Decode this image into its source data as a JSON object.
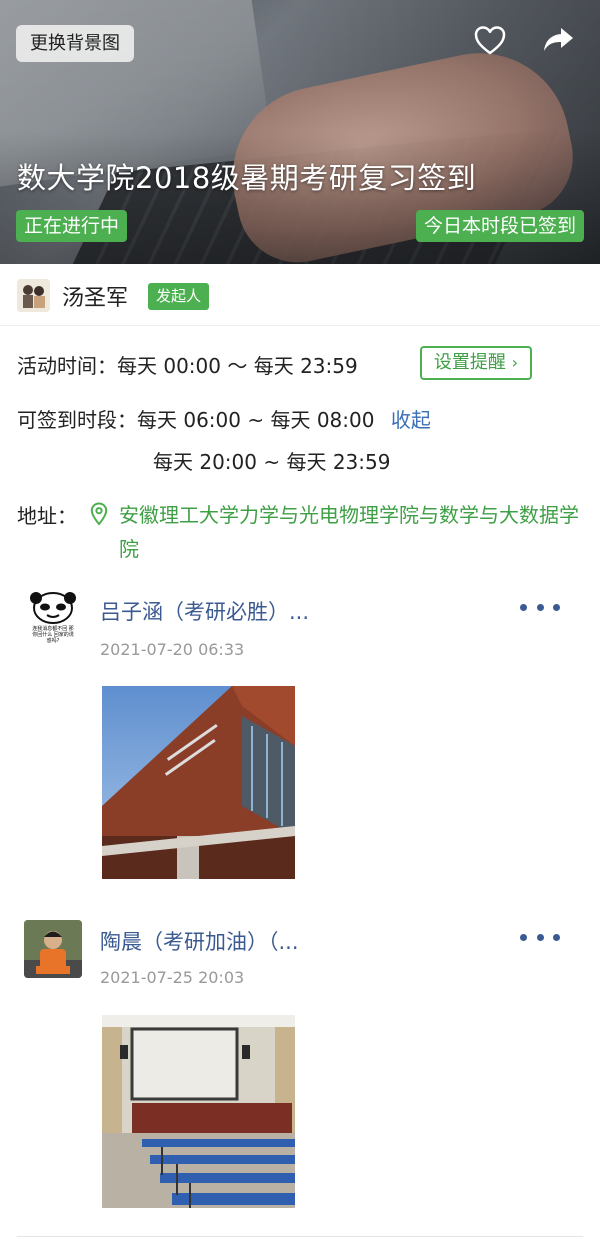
{
  "banner": {
    "change_bg_label": "更换背景图",
    "title": "数大学院2018级暑期考研复习签到",
    "status_left": "正在进行中",
    "status_right": "今日本时段已签到",
    "actions": [
      "heart-icon",
      "share-icon"
    ]
  },
  "organizer": {
    "name": "汤圣军",
    "tag": "发起人"
  },
  "info": {
    "activity_label": "活动时间：",
    "activity_value": "每天 00:00 ～ 每天 23:59",
    "remind_label": "设置提醒",
    "signin_label": "可签到时段：",
    "slot1": "每天 06:00 ~ 每天 08:00",
    "collapse_label": "收起",
    "slot2": "每天 20:00 ~ 每天 23:59",
    "address_label": "地址：",
    "address": "安徽理工大学力学与光电物理学院与数学与大数据学院"
  },
  "posts": [
    {
      "author": "吕子涵（考研必胜）...",
      "time": "2021-07-20 06:33",
      "avatar_text": "连我消息都不回 那你回什么 回家的诱惑吗?"
    },
    {
      "author": "陶晨（考研加油）（...",
      "time": "2021-07-25 20:03"
    }
  ],
  "colors": {
    "accent_green": "#4caf50",
    "link_blue": "#3a5a91",
    "address_green": "#3f9f45"
  }
}
